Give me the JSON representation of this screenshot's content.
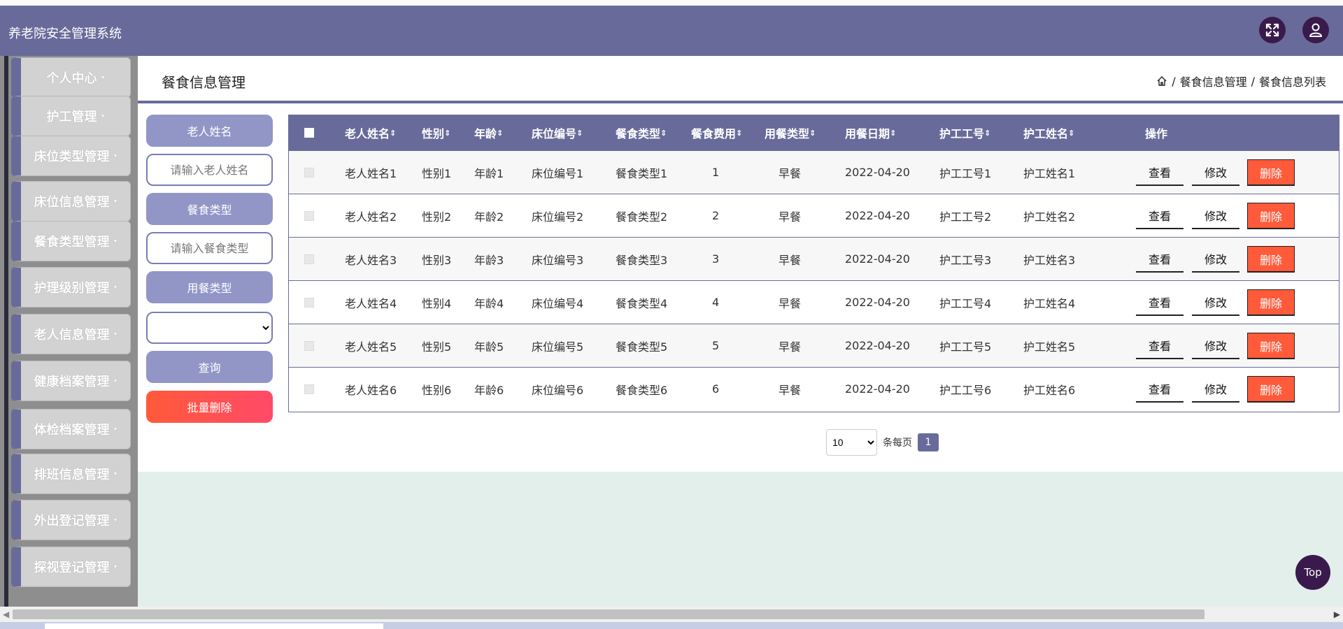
{
  "app": {
    "title": "养老院安全管理系统"
  },
  "header": {
    "expand_icon": "expand-icon",
    "user_icon": "user-icon"
  },
  "sidebar": {
    "items": [
      {
        "label": "个人中心"
      },
      {
        "label": "护工管理"
      },
      {
        "label": "床位类型管理"
      },
      {
        "label": "床位信息管理"
      },
      {
        "label": "餐食类型管理"
      },
      {
        "label": "护理级别管理"
      },
      {
        "label": "老人信息管理"
      },
      {
        "label": "健康档案管理"
      },
      {
        "label": "体检档案管理"
      },
      {
        "label": "排班信息管理"
      },
      {
        "label": "外出登记管理"
      },
      {
        "label": "探视登记管理"
      }
    ]
  },
  "page": {
    "title": "餐食信息管理",
    "breadcrumb": {
      "sep": "/",
      "level1": "餐食信息管理",
      "level2": "餐食信息列表"
    }
  },
  "filters": {
    "name_label": "老人姓名",
    "name_placeholder": "请输入老人姓名",
    "meal_type_label": "餐食类型",
    "meal_type_placeholder": "请输入餐食类型",
    "dining_type_label": "用餐类型",
    "dining_type_value": "",
    "search_label": "查询",
    "batch_delete_label": "批量删除"
  },
  "table": {
    "columns": [
      "老人姓名",
      "性别",
      "年龄",
      "床位编号",
      "餐食类型",
      "餐食费用",
      "用餐类型",
      "用餐日期",
      "护工工号",
      "护工姓名",
      "操作"
    ],
    "sort_glyph": "⇕",
    "rows": [
      [
        "老人姓名1",
        "性别1",
        "年龄1",
        "床位编号1",
        "餐食类型1",
        "1",
        "早餐",
        "2022-04-20",
        "护工工号1",
        "护工姓名1"
      ],
      [
        "老人姓名2",
        "性别2",
        "年龄2",
        "床位编号2",
        "餐食类型2",
        "2",
        "早餐",
        "2022-04-20",
        "护工工号2",
        "护工姓名2"
      ],
      [
        "老人姓名3",
        "性别3",
        "年龄3",
        "床位编号3",
        "餐食类型3",
        "3",
        "早餐",
        "2022-04-20",
        "护工工号3",
        "护工姓名3"
      ],
      [
        "老人姓名4",
        "性别4",
        "年龄4",
        "床位编号4",
        "餐食类型4",
        "4",
        "早餐",
        "2022-04-20",
        "护工工号4",
        "护工姓名4"
      ],
      [
        "老人姓名5",
        "性别5",
        "年龄5",
        "床位编号5",
        "餐食类型5",
        "5",
        "早餐",
        "2022-04-20",
        "护工工号5",
        "护工姓名5"
      ],
      [
        "老人姓名6",
        "性别6",
        "年龄6",
        "床位编号6",
        "餐食类型6",
        "6",
        "早餐",
        "2022-04-20",
        "护工工号6",
        "护工姓名6"
      ]
    ],
    "actions": {
      "view": "查看",
      "edit": "修改",
      "delete": "删除"
    }
  },
  "pagination": {
    "page_size": "10",
    "page_size_options": [
      "10"
    ],
    "per_page_label": "条每页",
    "current_page": "1"
  },
  "top_button": {
    "label": "Top"
  },
  "colors": {
    "primary": "#686b9a",
    "secondary": "#9196c7",
    "danger": "#ff5a3a",
    "dark": "#3a1a4c",
    "lower_bg": "#e3efea"
  }
}
